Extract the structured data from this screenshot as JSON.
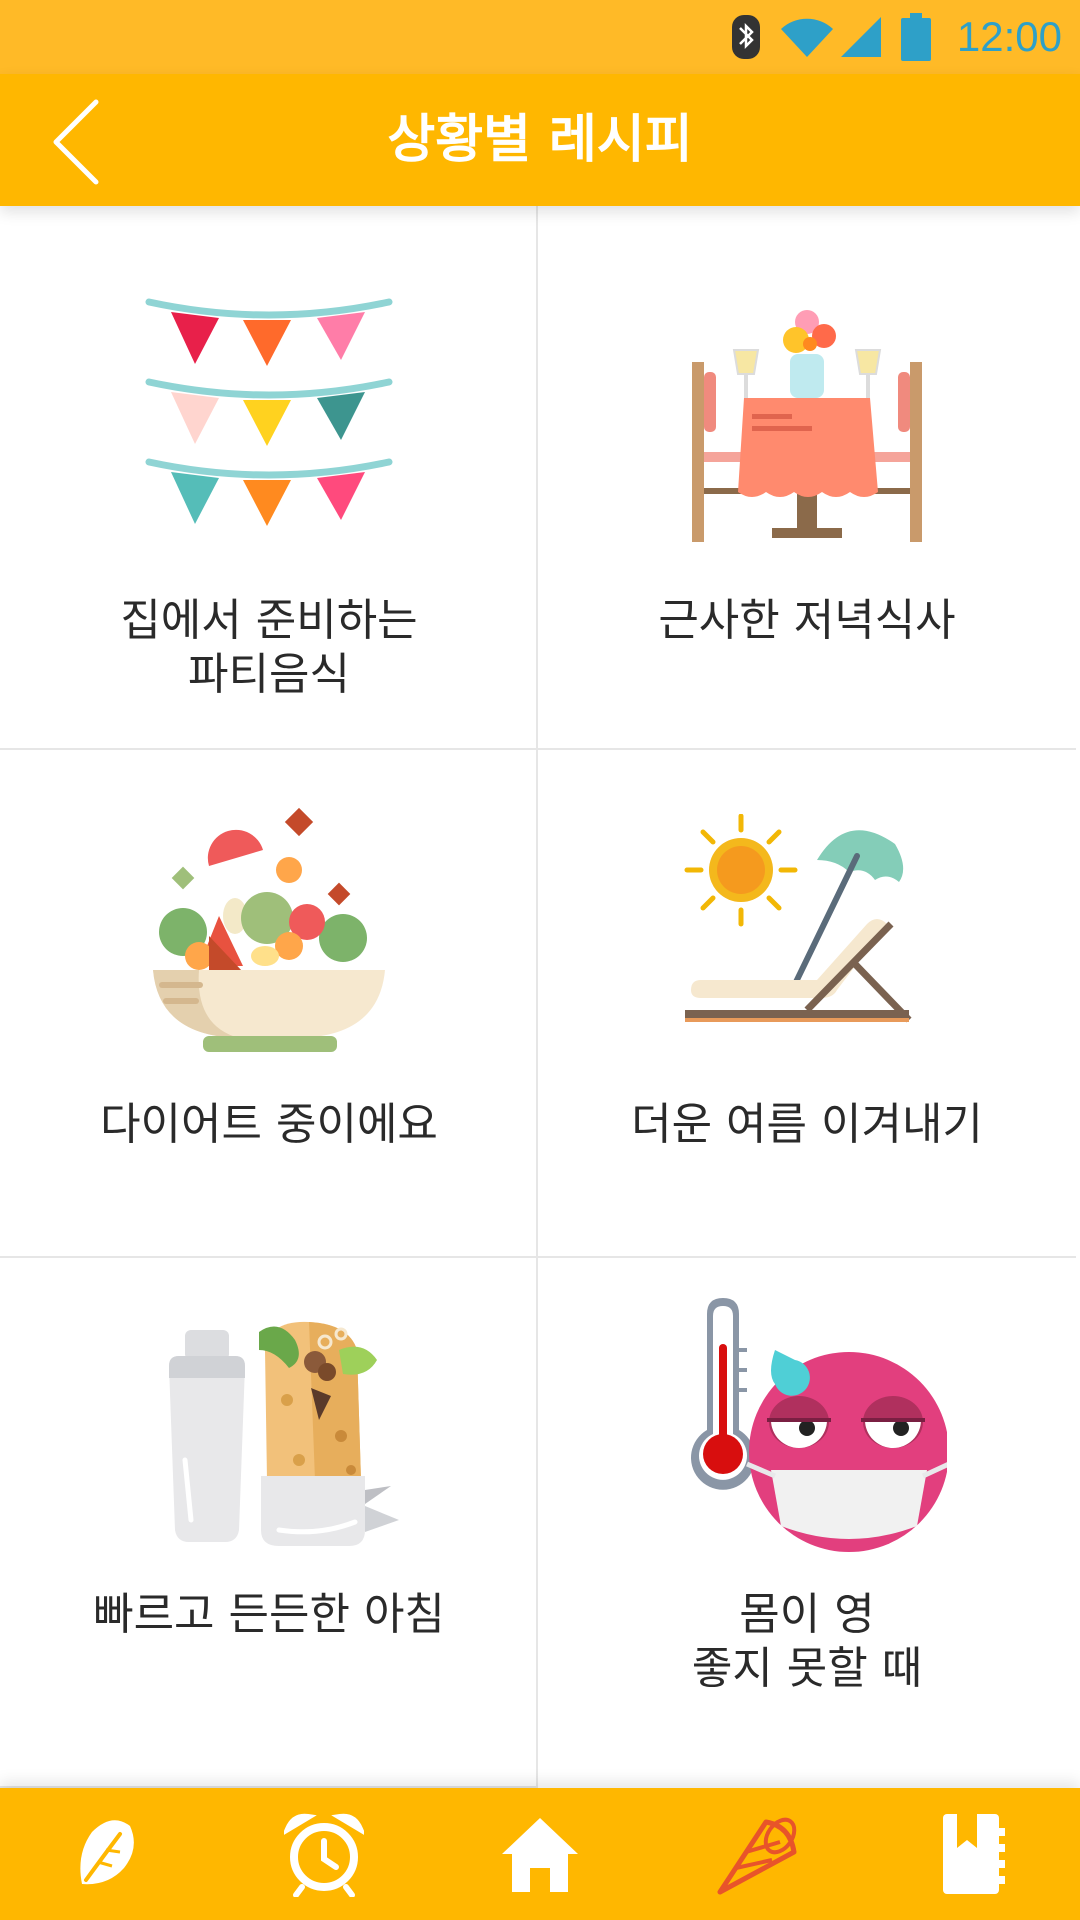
{
  "status_bar": {
    "time": "12:00",
    "icons": [
      "bluetooth-icon",
      "wifi-icon",
      "signal-icon",
      "battery-icon"
    ]
  },
  "app_bar": {
    "title": "상황별 레시피",
    "back_icon": "chevron-left-icon"
  },
  "categories": [
    {
      "line1": "집에서 준비하는",
      "line2": "파티음식",
      "icon": "party-bunting-icon"
    },
    {
      "line1": "근사한 저녁식사",
      "line2": "",
      "icon": "dinner-table-icon"
    },
    {
      "line1": "다이어트 중이에요",
      "line2": "",
      "icon": "salad-bowl-icon"
    },
    {
      "line1": "더운 여름 이겨내기",
      "line2": "",
      "icon": "beach-chair-icon"
    },
    {
      "line1": "빠르고 든든한 아침",
      "line2": "",
      "icon": "shaker-wrap-icon"
    },
    {
      "line1": "몸이 영",
      "line2": "좋지 못할 때",
      "icon": "sick-face-icon"
    }
  ],
  "bottom_nav": [
    {
      "icon": "leaf-icon",
      "active": false
    },
    {
      "icon": "alarm-clock-icon",
      "active": false
    },
    {
      "icon": "home-icon",
      "active": false
    },
    {
      "icon": "party-horn-icon",
      "active": true
    },
    {
      "icon": "notebook-icon",
      "active": false
    }
  ],
  "colors": {
    "status_bar": "#FFBA27",
    "app_bar": "#FFB700",
    "nav_active": "#E8542A",
    "text": "#2a2a2a"
  }
}
